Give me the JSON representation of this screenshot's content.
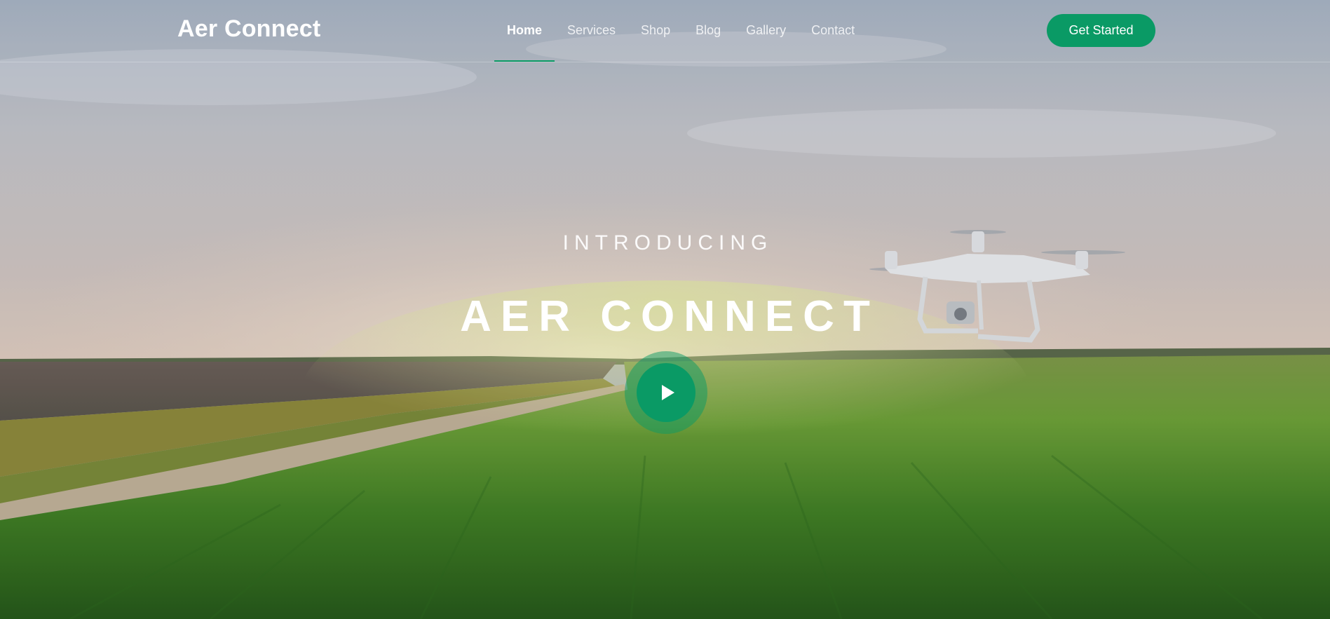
{
  "header": {
    "logo": "Aer Connect",
    "nav": [
      {
        "label": "Home",
        "active": true
      },
      {
        "label": "Services",
        "active": false
      },
      {
        "label": "Shop",
        "active": false
      },
      {
        "label": "Blog",
        "active": false
      },
      {
        "label": "Gallery",
        "active": false
      },
      {
        "label": "Contact",
        "active": false
      }
    ],
    "cta_label": "Get Started"
  },
  "hero": {
    "eyebrow": "INTRODUCING",
    "title": "AER CONNECT",
    "play_icon": "play-icon",
    "background": "landscape-photo-with-drone"
  },
  "colors": {
    "accent": "#0a9a65",
    "text": "#ffffff"
  }
}
